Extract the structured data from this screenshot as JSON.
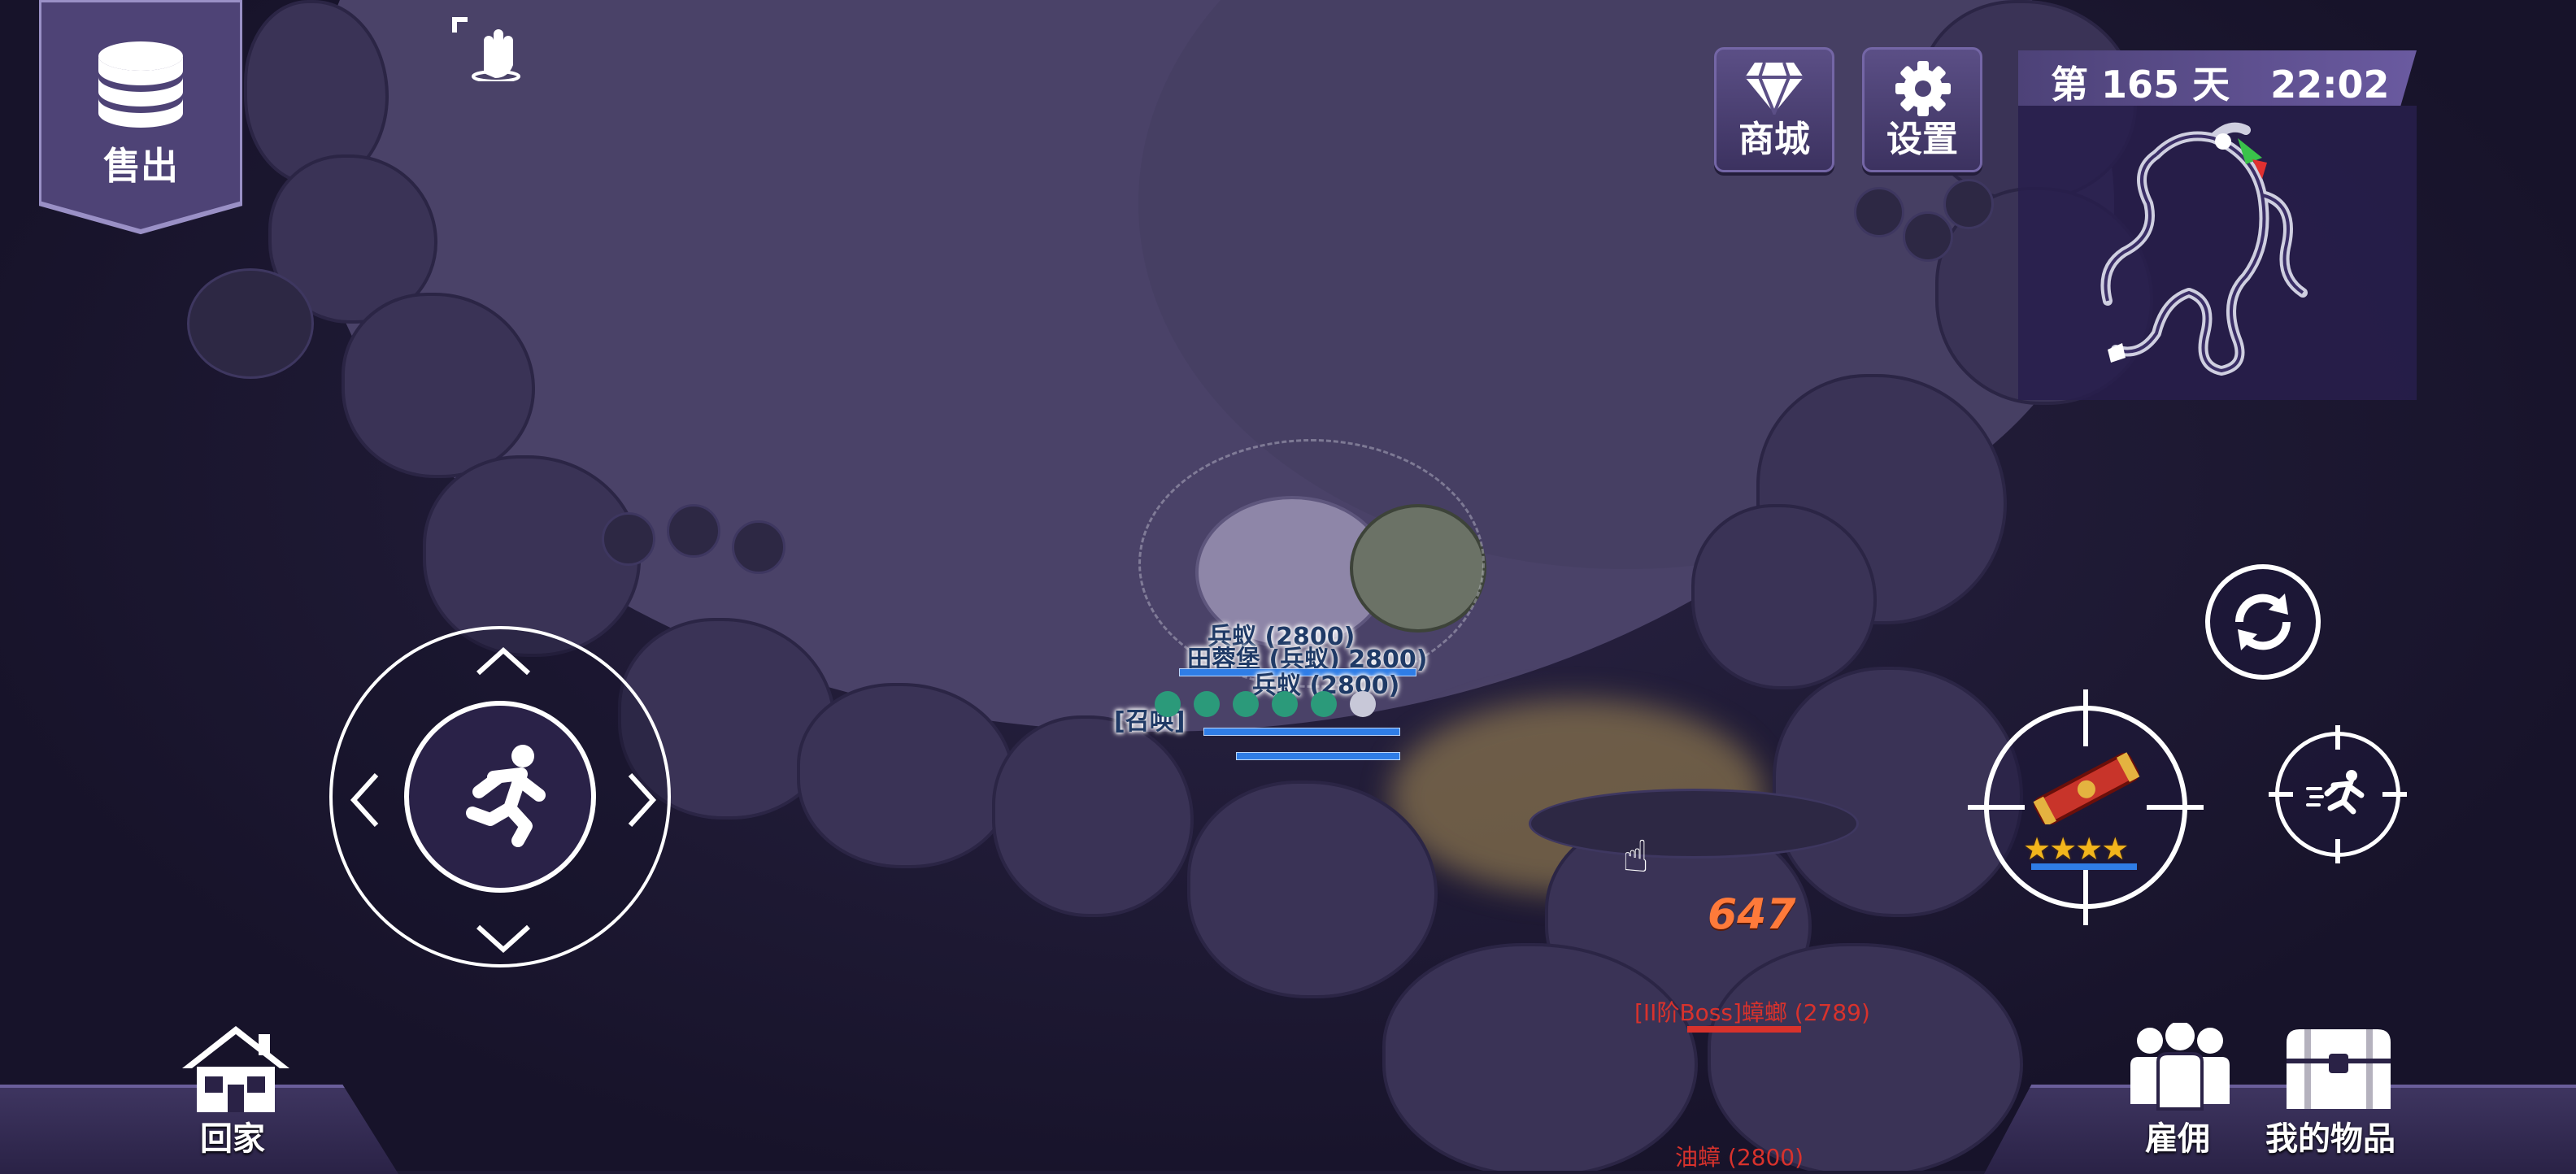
{
  "hud": {
    "sell_label": "售出",
    "shop_label": "商城",
    "settings_label": "设置",
    "day_prefix": "第",
    "day_number": "165",
    "day_suffix": "天",
    "clock": "22:02"
  },
  "bottom_bar": {
    "home_label": "回家",
    "hire_label": "雇佣",
    "items_label": "我的物品"
  },
  "world_labels": {
    "soldier_ant_1": "兵蚁 (2800)",
    "soldier_ant_2": "兵蚁 (2800)",
    "overlap_label": "田蓉堡 (兵蚁) 2800)",
    "summon_label": "[召唤]",
    "damage": "647",
    "boss_label": "[II阶Boss]蟑螂 (2789)",
    "bottom_enemy": "油蟑 (2800)"
  },
  "weapon": {
    "stars": 4
  },
  "colors": {
    "accent_purple": "#5b4f86",
    "damage_orange": "#ff7a3a",
    "boss_red": "#d8322c",
    "hp_blue": "#2f7de6"
  }
}
